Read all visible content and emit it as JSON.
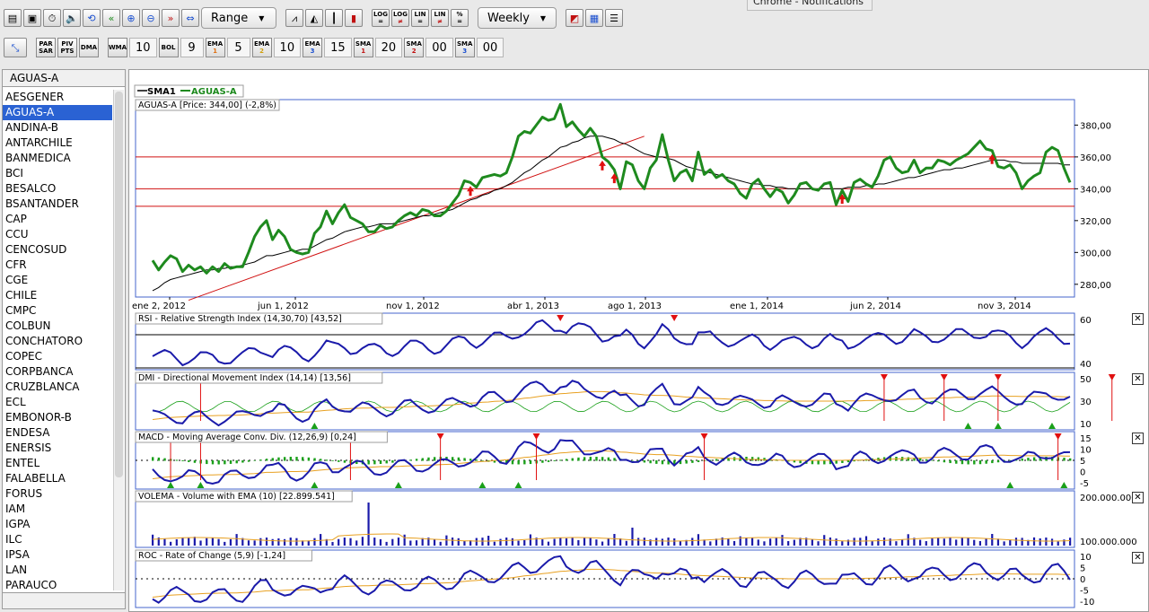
{
  "notification": "Chrome - Notifications",
  "toolbar1": {
    "period_select": "Range",
    "log_buttons": [
      {
        "top": "LOG",
        "bottom": "="
      },
      {
        "top": "LOG",
        "bottom": "≠"
      },
      {
        "top": "LIN",
        "bottom": "="
      },
      {
        "top": "LIN",
        "bottom": "≠"
      },
      {
        "top": "%",
        "bottom": "="
      }
    ],
    "interval_select": "Weekly"
  },
  "toolbar2": {
    "indicators": [
      {
        "top": "PAR",
        "bottom": "SAR"
      },
      {
        "top": "PIV",
        "bottom": "PTS"
      },
      {
        "top": "DMA",
        "bottom": ""
      },
      {
        "top": "WMA",
        "bottom": "",
        "value": "10"
      },
      {
        "top": "BOL",
        "bottom": "",
        "value": "9"
      },
      {
        "top": "EMA",
        "bottom": "1",
        "value": "5"
      },
      {
        "top": "EMA",
        "bottom": "2",
        "value": "10"
      },
      {
        "top": "EMA",
        "bottom": "3",
        "value": "15"
      },
      {
        "top": "SMA",
        "bottom": "1",
        "value": "20"
      },
      {
        "top": "SMA",
        "bottom": "2",
        "value": "00"
      },
      {
        "top": "SMA",
        "bottom": "3",
        "value": "00"
      }
    ]
  },
  "sidebar": {
    "title": "AGUAS-A",
    "selected": "AGUAS-A",
    "items": [
      "AESGENER",
      "AGUAS-A",
      "ANDINA-B",
      "ANTARCHILE",
      "BANMEDICA",
      "BCI",
      "BESALCO",
      "BSANTANDER",
      "CAP",
      "CCU",
      "CENCOSUD",
      "CFR",
      "CGE",
      "CHILE",
      "CMPC",
      "COLBUN",
      "CONCHATORO",
      "COPEC",
      "CORPBANCA",
      "CRUZBLANCA",
      "ECL",
      "EMBONOR-B",
      "ENDESA",
      "ENERSIS",
      "ENTEL",
      "FALABELLA",
      "FORUS",
      "IAM",
      "IGPA",
      "ILC",
      "IPSA",
      "LAN",
      "PARAUCO"
    ]
  },
  "colors": {
    "price": "#1e8a1e",
    "sma": "#000000",
    "indicator": "#1a1aaa",
    "signal": "#e8a020",
    "support": "#d01010",
    "sidebar_selected": "#2a62d3"
  },
  "chart_data": {
    "type": "line",
    "legend": [
      "SMA1",
      "AGUAS-A"
    ],
    "price_title": "AGUAS-A [Price: 344,00] (-2,8%)",
    "x_ticks": [
      "ene 2, 2012",
      "jun 1, 2012",
      "nov 1, 2012",
      "abr 1, 2013",
      "ago 1, 2013",
      "ene 1, 2014",
      "jun 2, 2014",
      "nov 3, 2014"
    ],
    "y_ticks": [
      "380,00",
      "360,00",
      "340,00",
      "320,00",
      "300,00",
      "280,00"
    ],
    "ylim": [
      272,
      396
    ],
    "support_lines": [
      360,
      340,
      329
    ],
    "series": [
      {
        "name": "AGUAS-A",
        "values": [
          295,
          289,
          294,
          298,
          296,
          288,
          292,
          289,
          291,
          287,
          291,
          288,
          293,
          290,
          291,
          291,
          300,
          310,
          316,
          320,
          308,
          314,
          310,
          302,
          300,
          299,
          300,
          312,
          316,
          326,
          318,
          325,
          330,
          322,
          320,
          318,
          313,
          313,
          317,
          315,
          316,
          320,
          323,
          325,
          323,
          327,
          326,
          323,
          323,
          326,
          331,
          336,
          345,
          344,
          341,
          347,
          348,
          349,
          348,
          350,
          360,
          373,
          376,
          375,
          380,
          385,
          383,
          384,
          393,
          379,
          382,
          377,
          373,
          378,
          373,
          360,
          357,
          352,
          340,
          357,
          355,
          345,
          340,
          353,
          358,
          374,
          358,
          345,
          350,
          352,
          345,
          363,
          349,
          352,
          347,
          349,
          345,
          343,
          337,
          334,
          343,
          346,
          340,
          335,
          340,
          338,
          331,
          336,
          343,
          344,
          340,
          339,
          343,
          344,
          330,
          339,
          332,
          344,
          346,
          343,
          341,
          348,
          358,
          360,
          353,
          350,
          351,
          358,
          350,
          353,
          353,
          358,
          357,
          355,
          358,
          360,
          362,
          366,
          370,
          365,
          364,
          354,
          353,
          355,
          350,
          340,
          345,
          348,
          350,
          363,
          366,
          364,
          353,
          344
        ]
      },
      {
        "name": "SMA1",
        "values": [
          276,
          278,
          281,
          283,
          284,
          285,
          286,
          287,
          288,
          289,
          289,
          290,
          290,
          291,
          291,
          292,
          293,
          294,
          296,
          298,
          298,
          299,
          300,
          301,
          301,
          302,
          302,
          304,
          306,
          308,
          309,
          311,
          313,
          314,
          315,
          316,
          316,
          317,
          318,
          318,
          318,
          319,
          320,
          321,
          322,
          323,
          323,
          324,
          325,
          326,
          327,
          329,
          331,
          333,
          334,
          336,
          337,
          339,
          340,
          342,
          344,
          347,
          350,
          352,
          355,
          358,
          360,
          363,
          366,
          367,
          369,
          370,
          372,
          373,
          373,
          373,
          372,
          371,
          369,
          368,
          366,
          364,
          362,
          361,
          360,
          360,
          359,
          358,
          356,
          354,
          353,
          352,
          351,
          350,
          349,
          348,
          347,
          346,
          345,
          344,
          343,
          343,
          342,
          342,
          341,
          341,
          340,
          340,
          340,
          340,
          340,
          340,
          340,
          340,
          340,
          340,
          341,
          341,
          341,
          342,
          342,
          343,
          343,
          344,
          345,
          346,
          347,
          347,
          348,
          349,
          350,
          351,
          352,
          352,
          353,
          353,
          354,
          355,
          356,
          357,
          358,
          358,
          358,
          357,
          357,
          356,
          356,
          356,
          356,
          356,
          356,
          356,
          355,
          355
        ]
      }
    ],
    "panels": [
      {
        "title": "RSI - Relative Strength Index (14,30,70) [43,52]",
        "y_ticks": [
          "60",
          "40"
        ]
      },
      {
        "title": "DMI - Directional Movement Index (14,14) [13,56]",
        "y_ticks": [
          "50",
          "30",
          "10"
        ]
      },
      {
        "title": "MACD - Moving Average Conv. Div. (12,26,9) [0,24]",
        "y_ticks": [
          "15",
          "10",
          "5",
          "0",
          "-5"
        ]
      },
      {
        "title": "VOLEMA - Volume with EMA (10) [22.899.541]",
        "y_ticks": [
          "200.000.000",
          "100.000.000"
        ]
      },
      {
        "title": "ROC - Rate of Change (5,9) [-1,24]",
        "y_ticks": [
          "10",
          "5",
          "0",
          "-5",
          "-10"
        ]
      }
    ]
  }
}
